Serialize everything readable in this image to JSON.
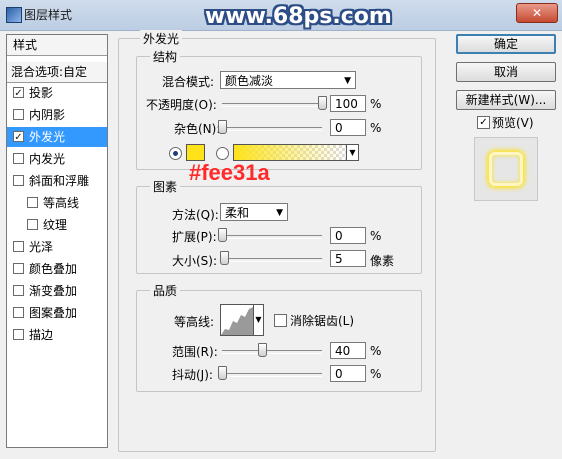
{
  "window": {
    "title": "图层样式",
    "close_glyph": "✕"
  },
  "watermark": "www.68ps.com",
  "annotation": {
    "text": "#fee31a",
    "color": "#ff2a2a"
  },
  "left_panel": {
    "header": "样式",
    "blend_options": "混合选项:自定",
    "items": [
      {
        "label": "投影",
        "checked": true
      },
      {
        "label": "内阴影",
        "checked": false
      },
      {
        "label": "外发光",
        "checked": true,
        "selected": true
      },
      {
        "label": "内发光",
        "checked": false
      },
      {
        "label": "斜面和浮雕",
        "checked": false
      },
      {
        "label": "等高线",
        "checked": false
      },
      {
        "label": "纹理",
        "checked": false
      },
      {
        "label": "光泽",
        "checked": false
      },
      {
        "label": "颜色叠加",
        "checked": false
      },
      {
        "label": "渐变叠加",
        "checked": false
      },
      {
        "label": "图案叠加",
        "checked": false
      },
      {
        "label": "描边",
        "checked": false
      }
    ]
  },
  "buttons": {
    "ok": "确定",
    "cancel": "取消",
    "new_style": "新建样式(W)...",
    "preview": "预览(V)"
  },
  "outer_glow": {
    "title": "外发光",
    "structure": {
      "title": "结构",
      "blend_mode_label": "混合模式:",
      "blend_mode_value": "颜色减淡",
      "opacity_label": "不透明度(O):",
      "opacity_value": "100",
      "opacity_unit": "%",
      "opacity_level": 1.0,
      "noise_label": "杂色(N):",
      "noise_value": "0",
      "noise_unit": "%",
      "noise_level": 0.0,
      "glow_color": "#fee31a"
    },
    "elements": {
      "title": "图素",
      "technique_label": "方法(Q):",
      "technique_value": "柔和",
      "spread_label": "扩展(P):",
      "spread_value": "0",
      "spread_unit": "%",
      "spread_level": 0.0,
      "size_label": "大小(S):",
      "size_value": "5",
      "size_unit": "像素",
      "size_level": 0.02
    },
    "quality": {
      "title": "品质",
      "contour_label": "等高线:",
      "anti_alias_label": "消除锯齿(L)",
      "range_label": "范围(R):",
      "range_value": "40",
      "range_unit": "%",
      "range_level": 0.4,
      "jitter_label": "抖动(J):",
      "jitter_value": "0",
      "jitter_unit": "%",
      "jitter_level": 0.0
    }
  }
}
